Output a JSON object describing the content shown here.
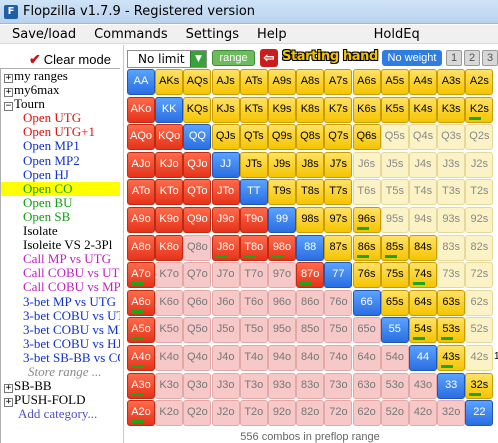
{
  "title": "Flopzilla v1.7.9 - Registered version",
  "menu": [
    "Save/load",
    "Commands",
    "Settings",
    "Help",
    "HoldEq"
  ],
  "sidebar": {
    "clear_mode": "Clear mode",
    "tree": [
      {
        "label": "my ranges",
        "type": "root",
        "expander": "+",
        "color": "#000000"
      },
      {
        "label": "my6max",
        "type": "root",
        "expander": "+",
        "color": "#000000"
      },
      {
        "label": "Tourn",
        "type": "root",
        "expander": "−",
        "color": "#000000"
      },
      {
        "label": "Open UTG",
        "type": "child",
        "color": "#e01010"
      },
      {
        "label": "Open UTG+1",
        "type": "child",
        "color": "#e01010"
      },
      {
        "label": "Open MP1",
        "type": "child",
        "color": "#1030d0"
      },
      {
        "label": "Open MP2",
        "type": "child",
        "color": "#1030d0"
      },
      {
        "label": "Open HJ",
        "type": "child",
        "color": "#1030d0"
      },
      {
        "label": "Open CO",
        "type": "child",
        "color": "#10a010",
        "highlight": true
      },
      {
        "label": "Open BU",
        "type": "child",
        "color": "#10a010"
      },
      {
        "label": "Open SB",
        "type": "child",
        "color": "#10a010"
      },
      {
        "label": "Isolate",
        "type": "child",
        "color": "#000000"
      },
      {
        "label": "Isoleite VS 2-3Pl",
        "type": "child",
        "color": "#000000"
      },
      {
        "label": "Call MP vs UTG",
        "type": "child",
        "color": "#c020c0"
      },
      {
        "label": "Call COBU vs UTG",
        "type": "child",
        "color": "#c020c0"
      },
      {
        "label": "Call COBU vs MP2",
        "type": "child",
        "color": "#c020c0"
      },
      {
        "label": "3-bet MP vs UTG",
        "type": "child",
        "color": "#1030d0"
      },
      {
        "label": "3-bet COBU vs UTG",
        "type": "child",
        "color": "#1030d0"
      },
      {
        "label": "3-bet COBU vs MP",
        "type": "child",
        "color": "#1030d0"
      },
      {
        "label": "3-bet COBU vs HJ",
        "type": "child",
        "color": "#1030d0"
      },
      {
        "label": "3-bet SB-BB vs CO",
        "type": "child",
        "color": "#1030d0"
      },
      {
        "label": "Store range ...",
        "type": "store",
        "color": "#888888"
      },
      {
        "label": "SB-BB",
        "type": "root",
        "expander": "+",
        "color": "#000000"
      },
      {
        "label": "PUSH-FOLD",
        "type": "root",
        "expander": "+",
        "color": "#000000"
      },
      {
        "label": "Add category...",
        "type": "footer",
        "color": "#5050c8"
      }
    ]
  },
  "toolbar": {
    "dropdown_value": "No limit",
    "range_label": "range",
    "starting_hand_label": "Starting hand",
    "no_weight_label": "No weight",
    "numbers": [
      "1",
      "2",
      "3"
    ]
  },
  "grid": {
    "rows": [
      [
        "AA",
        "AKs",
        "AQs",
        "AJs",
        "ATs",
        "A9s",
        "A8s",
        "A7s",
        "A6s",
        "A5s",
        "A4s",
        "A3s",
        "A2s"
      ],
      [
        "AKo",
        "KK",
        "KQs",
        "KJs",
        "KTs",
        "K9s",
        "K8s",
        "K7s",
        "K6s",
        "K5s",
        "K4s",
        "K3s",
        "K2s"
      ],
      [
        "AQo",
        "KQo",
        "QQ",
        "QJs",
        "QTs",
        "Q9s",
        "Q8s",
        "Q7s",
        "Q6s",
        "Q5s",
        "Q4s",
        "Q3s",
        "Q2s"
      ],
      [
        "AJo",
        "KJo",
        "QJo",
        "JJ",
        "JTs",
        "J9s",
        "J8s",
        "J7s",
        "J6s",
        "J5s",
        "J4s",
        "J3s",
        "J2s"
      ],
      [
        "ATo",
        "KTo",
        "QTo",
        "JTo",
        "TT",
        "T9s",
        "T8s",
        "T7s",
        "T6s",
        "T5s",
        "T4s",
        "T3s",
        "T2s"
      ],
      [
        "A9o",
        "K9o",
        "Q9o",
        "J9o",
        "T9o",
        "99",
        "98s",
        "97s",
        "96s",
        "95s",
        "94s",
        "93s",
        "92s"
      ],
      [
        "A8o",
        "K8o",
        "Q8o",
        "J8o",
        "T8o",
        "98o",
        "88",
        "87s",
        "86s",
        "85s",
        "84s",
        "83s",
        "82s"
      ],
      [
        "A7o",
        "K7o",
        "Q7o",
        "J7o",
        "T7o",
        "97o",
        "87o",
        "77",
        "76s",
        "75s",
        "74s",
        "73s",
        "72s"
      ],
      [
        "A6o",
        "K6o",
        "Q6o",
        "J6o",
        "T6o",
        "96o",
        "86o",
        "76o",
        "66",
        "65s",
        "64s",
        "63s",
        "62s"
      ],
      [
        "A5o",
        "K5o",
        "Q5o",
        "J5o",
        "T5o",
        "95o",
        "85o",
        "75o",
        "65o",
        "55",
        "54s",
        "53s",
        "52s"
      ],
      [
        "A4o",
        "K4o",
        "Q4o",
        "J4o",
        "T4o",
        "94o",
        "84o",
        "74o",
        "64o",
        "54o",
        "44",
        "43s",
        "42s"
      ],
      [
        "A3o",
        "K3o",
        "Q3o",
        "J3o",
        "T3o",
        "93o",
        "83o",
        "73o",
        "63o",
        "53o",
        "43o",
        "33",
        "32s"
      ],
      [
        "A2o",
        "K2o",
        "Q2o",
        "J2o",
        "T2o",
        "92o",
        "82o",
        "72o",
        "62o",
        "52o",
        "42o",
        "32o",
        "22"
      ]
    ],
    "selected": [
      [
        1,
        1,
        1,
        1,
        1,
        1,
        1,
        1,
        1,
        1,
        1,
        1,
        1
      ],
      [
        1,
        1,
        1,
        1,
        1,
        1,
        1,
        1,
        1,
        1,
        1,
        1,
        1
      ],
      [
        1,
        1,
        1,
        1,
        1,
        1,
        1,
        1,
        1,
        0,
        0,
        0,
        0
      ],
      [
        1,
        1,
        1,
        1,
        1,
        1,
        1,
        1,
        0,
        0,
        0,
        0,
        0
      ],
      [
        1,
        1,
        1,
        1,
        1,
        1,
        1,
        1,
        0,
        0,
        0,
        0,
        0
      ],
      [
        1,
        1,
        1,
        1,
        1,
        1,
        1,
        1,
        1,
        0,
        0,
        0,
        0
      ],
      [
        1,
        1,
        0,
        1,
        1,
        1,
        1,
        1,
        1,
        1,
        1,
        0,
        0
      ],
      [
        1,
        0,
        0,
        0,
        0,
        0,
        1,
        1,
        1,
        1,
        1,
        0,
        0
      ],
      [
        1,
        0,
        0,
        0,
        0,
        0,
        0,
        0,
        1,
        1,
        1,
        1,
        0
      ],
      [
        1,
        0,
        0,
        0,
        0,
        0,
        0,
        0,
        0,
        1,
        1,
        1,
        0
      ],
      [
        1,
        0,
        0,
        0,
        0,
        0,
        0,
        0,
        0,
        0,
        1,
        1,
        0
      ],
      [
        1,
        0,
        0,
        0,
        0,
        0,
        0,
        0,
        0,
        0,
        0,
        1,
        1
      ],
      [
        1,
        0,
        0,
        0,
        0,
        0,
        0,
        0,
        0,
        0,
        0,
        0,
        1
      ]
    ],
    "weight_bars": [
      [
        0,
        0,
        0,
        0,
        0,
        0,
        0,
        0,
        0,
        0,
        0,
        0,
        0
      ],
      [
        0,
        0,
        0,
        0,
        0,
        0,
        0,
        0,
        0,
        0,
        0,
        0,
        1
      ],
      [
        0,
        0,
        0,
        0,
        0,
        0,
        0,
        0,
        0,
        0,
        0,
        0,
        0
      ],
      [
        0,
        0,
        0,
        0,
        0,
        0,
        0,
        0,
        0,
        0,
        0,
        0,
        0
      ],
      [
        0,
        0,
        0,
        0,
        0,
        0,
        0,
        0,
        0,
        0,
        0,
        0,
        0
      ],
      [
        0,
        0,
        0,
        0,
        0,
        0,
        0,
        0,
        1,
        0,
        0,
        0,
        0
      ],
      [
        0,
        0,
        0,
        1,
        1,
        1,
        0,
        0,
        1,
        1,
        0,
        0,
        0
      ],
      [
        1,
        0,
        0,
        0,
        0,
        0,
        1,
        0,
        0,
        0,
        1,
        0,
        0
      ],
      [
        1,
        0,
        0,
        0,
        0,
        0,
        0,
        0,
        0,
        0,
        0,
        0,
        0
      ],
      [
        1,
        0,
        0,
        0,
        0,
        0,
        0,
        0,
        0,
        0,
        1,
        1,
        0
      ],
      [
        1,
        0,
        0,
        0,
        0,
        0,
        0,
        0,
        0,
        0,
        0,
        1,
        0
      ],
      [
        1,
        0,
        0,
        0,
        0,
        0,
        0,
        0,
        0,
        0,
        0,
        0,
        1
      ],
      [
        1,
        0,
        0,
        0,
        0,
        0,
        0,
        0,
        0,
        0,
        0,
        0,
        0
      ]
    ],
    "colors": {
      "offsuit_selected": "#ee4422",
      "pair_selected": "#3b82e8",
      "suited_selected": "#f5c400",
      "offsuit_unselected": "#f6c8c8",
      "pair_unselected": "#c9dbf3",
      "suited_unselected": "#fbf3c6",
      "weight_bar": "#18a818"
    }
  },
  "status": "556 combos in preflop range"
}
